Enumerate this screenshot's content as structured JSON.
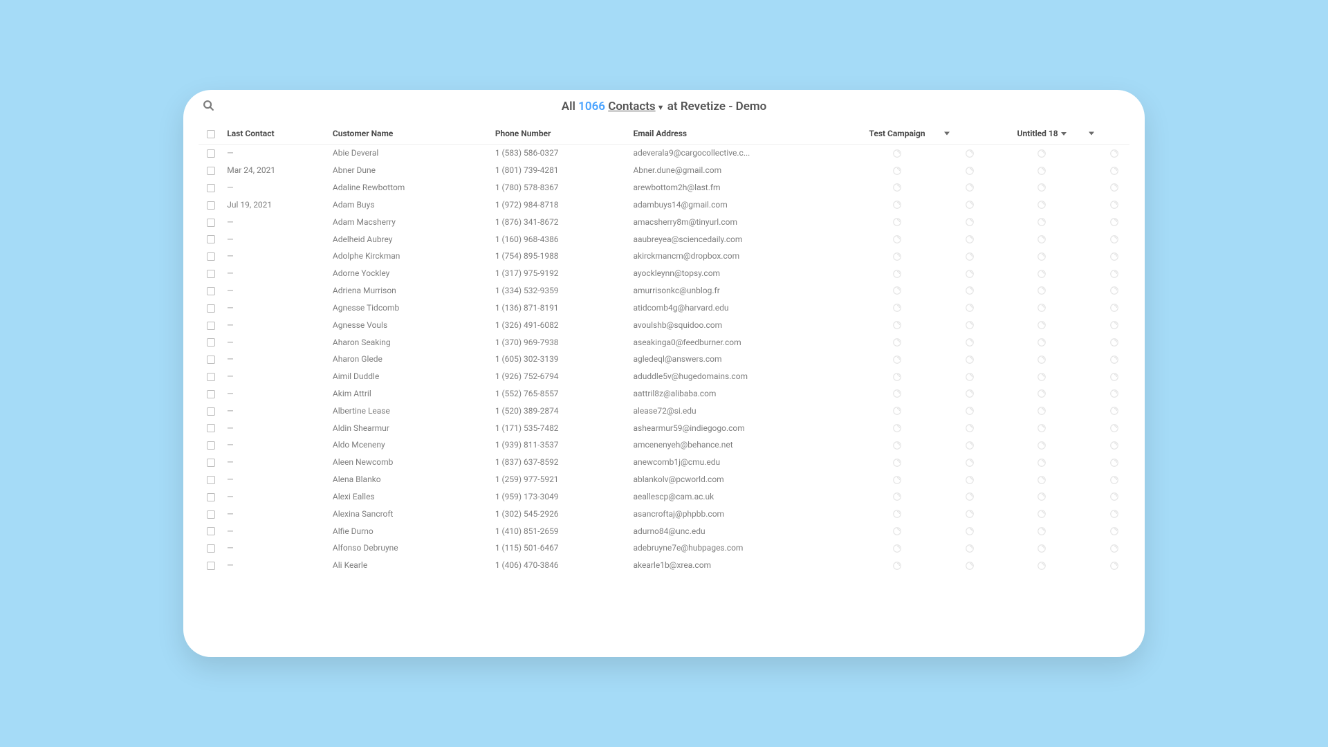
{
  "title": {
    "all": "All",
    "count": "1066",
    "contacts": "Contacts",
    "suffix": "at Revetize - Demo"
  },
  "headers": {
    "last_contact": "Last Contact",
    "customer_name": "Customer Name",
    "phone_number": "Phone Number",
    "email_address": "Email Address",
    "test_campaign": "Test Campaign",
    "untitled": "Untitled 18"
  },
  "rows": [
    {
      "last": "—",
      "name": "Abie Deveral",
      "phone": "1 (583) 586-0327",
      "email": "adeverala9@cargocollective.c..."
    },
    {
      "last": "Mar 24, 2021",
      "name": "Abner Dune",
      "phone": "1 (801) 739-4281",
      "email": "Abner.dune@gmail.com"
    },
    {
      "last": "—",
      "name": "Adaline Rewbottom",
      "phone": "1 (780) 578-8367",
      "email": "arewbottom2h@last.fm"
    },
    {
      "last": "Jul 19, 2021",
      "name": "Adam Buys",
      "phone": "1 (972) 984-8718",
      "email": "adambuys14@gmail.com"
    },
    {
      "last": "—",
      "name": "Adam Macsherry",
      "phone": "1 (876) 341-8672",
      "email": "amacsherry8m@tinyurl.com"
    },
    {
      "last": "—",
      "name": "Adelheid Aubrey",
      "phone": "1 (160) 968-4386",
      "email": "aaubreyea@sciencedaily.com"
    },
    {
      "last": "—",
      "name": "Adolphe Kirckman",
      "phone": "1 (754) 895-1988",
      "email": "akirckmancm@dropbox.com"
    },
    {
      "last": "—",
      "name": "Adorne Yockley",
      "phone": "1 (317) 975-9192",
      "email": "ayockleynn@topsy.com"
    },
    {
      "last": "—",
      "name": "Adriena Murrison",
      "phone": "1 (334) 532-9359",
      "email": "amurrisonkc@unblog.fr"
    },
    {
      "last": "—",
      "name": "Agnesse Tidcomb",
      "phone": "1 (136) 871-8191",
      "email": "atidcomb4g@harvard.edu"
    },
    {
      "last": "—",
      "name": "Agnesse Vouls",
      "phone": "1 (326) 491-6082",
      "email": "avoulshb@squidoo.com"
    },
    {
      "last": "—",
      "name": "Aharon Seaking",
      "phone": "1 (370) 969-7938",
      "email": "aseakinga0@feedburner.com"
    },
    {
      "last": "—",
      "name": "Aharon Glede",
      "phone": "1 (605) 302-3139",
      "email": "agledeql@answers.com"
    },
    {
      "last": "—",
      "name": "Aimil Duddle",
      "phone": "1 (926) 752-6794",
      "email": "aduddle5v@hugedomains.com"
    },
    {
      "last": "—",
      "name": "Akim Attril",
      "phone": "1 (552) 765-8557",
      "email": "aattril8z@alibaba.com"
    },
    {
      "last": "—",
      "name": "Albertine Lease",
      "phone": "1 (520) 389-2874",
      "email": "alease72@si.edu"
    },
    {
      "last": "—",
      "name": "Aldin Shearmur",
      "phone": "1 (171) 535-7482",
      "email": "ashearmur59@indiegogo.com"
    },
    {
      "last": "—",
      "name": "Aldo Mceneny",
      "phone": "1 (939) 811-3537",
      "email": "amcenenyeh@behance.net"
    },
    {
      "last": "—",
      "name": "Aleen Newcomb",
      "phone": "1 (837) 637-8592",
      "email": "anewcomb1j@cmu.edu"
    },
    {
      "last": "—",
      "name": "Alena Blanko",
      "phone": "1 (259) 977-5921",
      "email": "ablankolv@pcworld.com"
    },
    {
      "last": "—",
      "name": "Alexi Ealles",
      "phone": "1 (959) 173-3049",
      "email": "aeallescp@cam.ac.uk"
    },
    {
      "last": "—",
      "name": "Alexina Sancroft",
      "phone": "1 (302) 545-2926",
      "email": "asancroftaj@phpbb.com"
    },
    {
      "last": "—",
      "name": "Alfie Durno",
      "phone": "1 (410) 851-2659",
      "email": "adurno84@unc.edu"
    },
    {
      "last": "—",
      "name": "Alfonso Debruyne",
      "phone": "1 (115) 501-6467",
      "email": "adebruyne7e@hubpages.com"
    },
    {
      "last": "—",
      "name": "Ali Kearle",
      "phone": "1 (406) 470-3846",
      "email": "akearle1b@xrea.com"
    }
  ]
}
